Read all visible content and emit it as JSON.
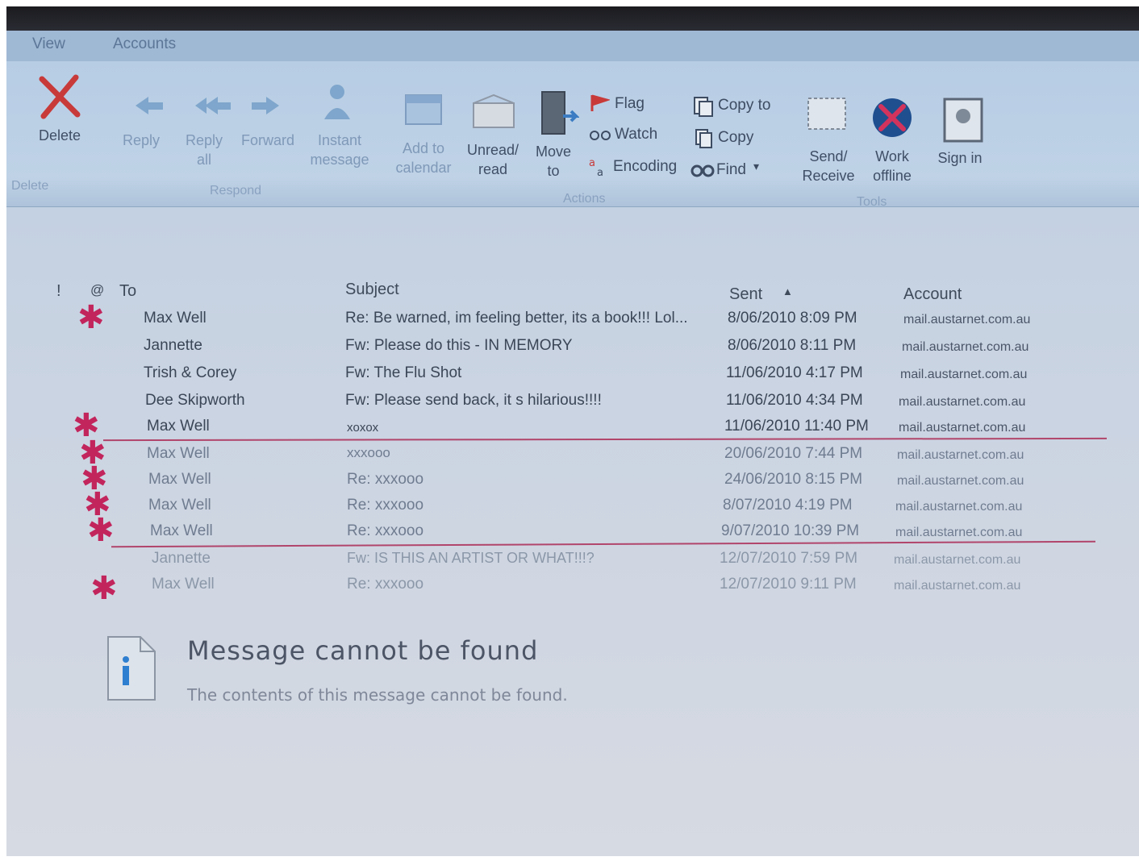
{
  "menu": {
    "items": [
      "View",
      "Accounts"
    ]
  },
  "ribbon": {
    "delete": "Delete",
    "reply": "Reply",
    "reply_all": "Reply all",
    "forward": "Forward",
    "instant_message": "Instant message",
    "add_calendar": "Add to calendar",
    "unread_read": "Unread/ read",
    "move_to": "Move to",
    "flag": "Flag",
    "watch": "Watch",
    "encoding": "Encoding",
    "copy_to": "Copy to",
    "copy": "Copy",
    "find": "Find",
    "send_receive": "Send/ Receive",
    "work_offline": "Work offline",
    "sign_in": "Sign in",
    "group_delete": "Delete",
    "group_respond": "Respond",
    "group_actions": "Actions",
    "group_tools": "Tools"
  },
  "columns": {
    "importance": "!",
    "attachment": "@",
    "to": "To",
    "subject": "Subject",
    "sent": "Sent",
    "account": "Account"
  },
  "messages": [
    {
      "to": "Max Well",
      "subject": "Re: Be warned, im feeling better, its a book!!! Lol...",
      "sent": "8/06/2010 8:09 PM",
      "account": "mail.austarnet.com.au",
      "marked": true
    },
    {
      "to": "Jannette",
      "subject": "Fw: Please do this - IN MEMORY",
      "sent": "8/06/2010 8:11 PM",
      "account": "mail.austarnet.com.au",
      "marked": false
    },
    {
      "to": "Trish & Corey",
      "subject": "Fw: The Flu Shot",
      "sent": "11/06/2010 4:17 PM",
      "account": "mail.austarnet.com.au",
      "marked": false
    },
    {
      "to": "Dee Skipworth",
      "subject": "Fw: Please send back, it s hilarious!!!!",
      "sent": "11/06/2010 4:34 PM",
      "account": "mail.austarnet.com.au",
      "marked": false
    },
    {
      "to": "Max Well",
      "subject": "xoxox",
      "sent": "11/06/2010 11:40 PM",
      "account": "mail.austarnet.com.au",
      "marked": true
    },
    {
      "to": "Max Well",
      "subject": "xxxooo",
      "sent": "20/06/2010 7:44 PM",
      "account": "mail.austarnet.com.au",
      "marked": true
    },
    {
      "to": "Max Well",
      "subject": "Re: xxxooo",
      "sent": "24/06/2010 8:15 PM",
      "account": "mail.austarnet.com.au",
      "marked": true
    },
    {
      "to": "Max Well",
      "subject": "Re: xxxooo",
      "sent": "8/07/2010 4:19 PM",
      "account": "mail.austarnet.com.au",
      "marked": true
    },
    {
      "to": "Max Well",
      "subject": "Re: xxxooo",
      "sent": "9/07/2010 10:39 PM",
      "account": "mail.austarnet.com.au",
      "marked": true
    },
    {
      "to": "Jannette",
      "subject": "Fw: IS THIS AN ARTIST OR WHAT!!!?",
      "sent": "12/07/2010 7:59 PM",
      "account": "mail.austarnet.com.au",
      "marked": false
    },
    {
      "to": "Max Well",
      "subject": "Re: xxxooo",
      "sent": "12/07/2010 9:11 PM",
      "account": "mail.austarnet.com.au",
      "marked": true
    }
  ],
  "notice": {
    "title": "Message cannot be found",
    "body": "The contents of this message cannot be found."
  },
  "colors": {
    "annotation": "#c2255c",
    "ribbon": "#bccfe3"
  }
}
